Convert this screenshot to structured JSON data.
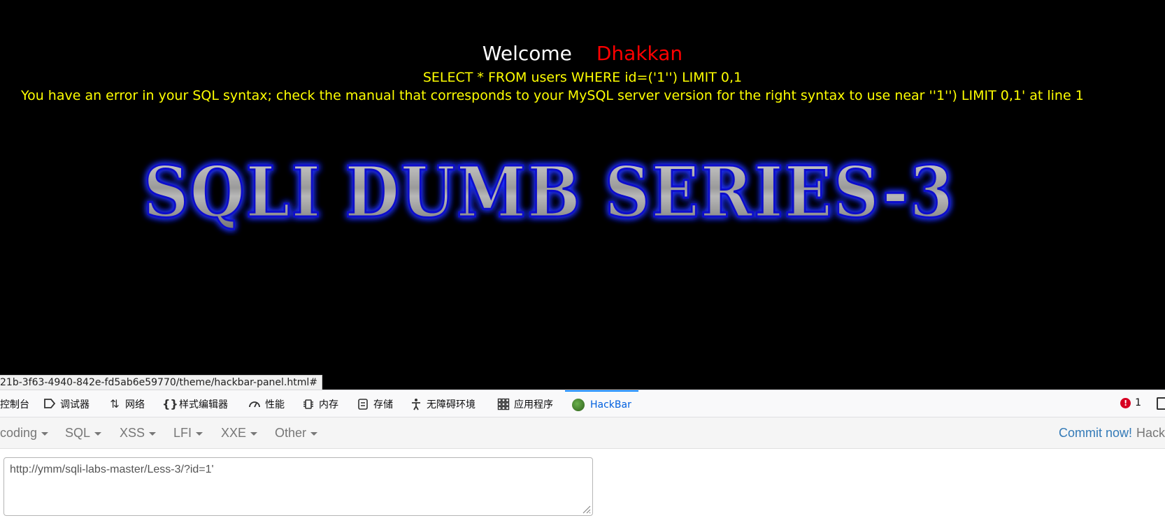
{
  "page": {
    "welcome": "Welcome",
    "username": "Dhakkan",
    "query": "SELECT * FROM users WHERE id=('1'') LIMIT 0,1",
    "error": "You have an error in your SQL syntax; check the manual that corresponds to your MySQL server version for the right syntax to use near ''1'') LIMIT 0,1' at line 1",
    "banner": "SQLI DUMB SERIES-3"
  },
  "status_bar": {
    "url": "21b-3f63-4940-842e-fd5ab6e59770/theme/hackbar-panel.html#"
  },
  "devtools": {
    "tabs": [
      {
        "label": "控制台",
        "icon": "console-icon"
      },
      {
        "label": "调试器",
        "icon": "debugger-icon"
      },
      {
        "label": "网络",
        "icon": "network-icon"
      },
      {
        "label": "样式编辑器",
        "icon": "style-editor-icon"
      },
      {
        "label": "性能",
        "icon": "performance-icon"
      },
      {
        "label": "内存",
        "icon": "memory-icon"
      },
      {
        "label": "存储",
        "icon": "storage-icon"
      },
      {
        "label": "无障碍环境",
        "icon": "accessibility-icon"
      },
      {
        "label": "应用程序",
        "icon": "application-icon"
      },
      {
        "label": "HackBar",
        "icon": "hackbar-icon",
        "active": true
      }
    ],
    "error_count": "1"
  },
  "hackbar": {
    "menus": [
      "coding",
      "SQL",
      "XSS",
      "LFI",
      "XXE",
      "Other"
    ],
    "commit_link": "Commit now!",
    "commit_brand": "Hack",
    "url_value": "http://ymm/sqli-labs-master/Less-3/?id=1'"
  },
  "colors": {
    "background": "#000000",
    "welcome": "#ffffff",
    "username": "#ff0000",
    "sql_text": "#ffff00",
    "banner_glow": "#1a1aff",
    "active_tab": "#0060df",
    "commit_link": "#337ab7"
  }
}
